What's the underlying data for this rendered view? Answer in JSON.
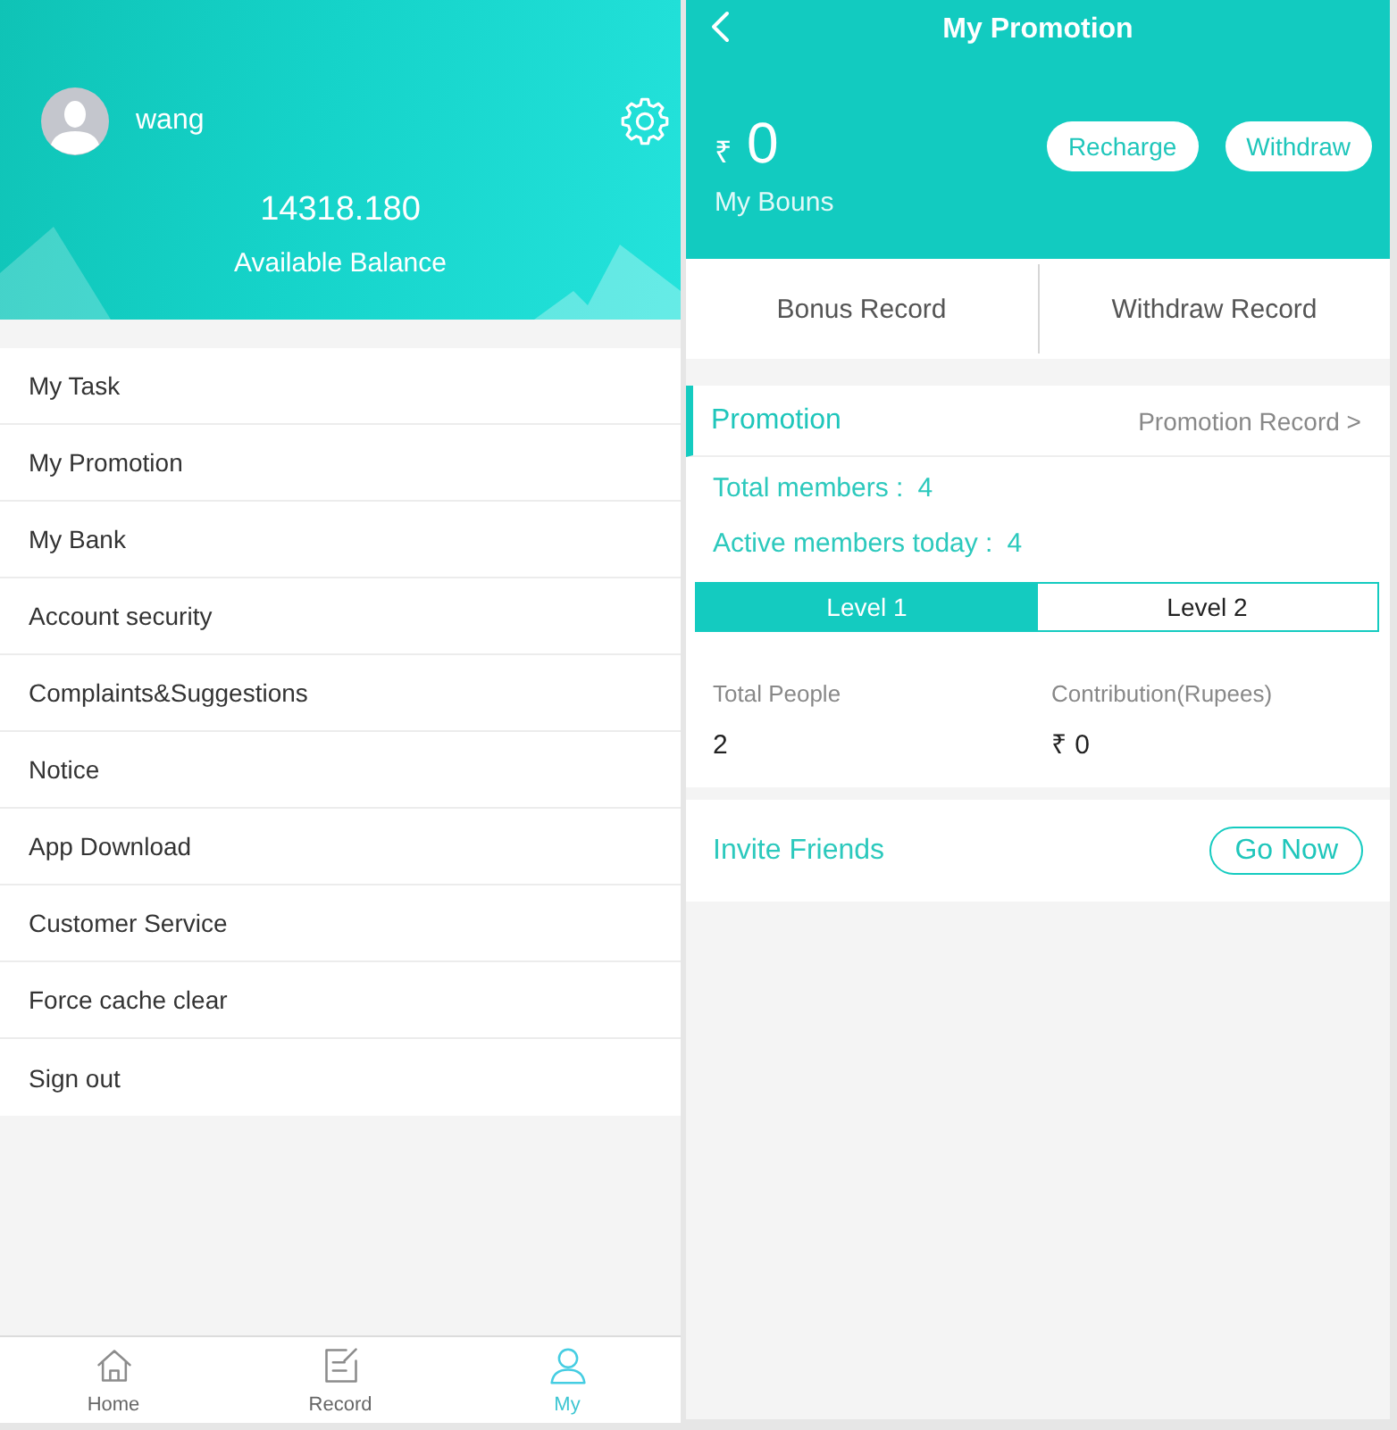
{
  "profile_screen": {
    "username": "wang",
    "balance": "14318.180",
    "balance_label": "Available Balance",
    "menu": [
      "My Task",
      "My Promotion",
      "My Bank",
      "Account security",
      "Complaints&Suggestions",
      "Notice",
      "App Download",
      "Customer Service",
      "Force cache clear",
      "Sign out"
    ],
    "tab_bar": [
      {
        "kind": "home",
        "label": "Home",
        "selected": false
      },
      {
        "kind": "record",
        "label": "Record",
        "selected": false
      },
      {
        "kind": "profile",
        "label": "My",
        "selected": true
      }
    ]
  },
  "promotion_screen": {
    "title": "My Promotion",
    "bonus": {
      "currency": "₹",
      "amount": "0",
      "label": "My Bouns"
    },
    "actions": [
      "Recharge",
      "Withdraw"
    ],
    "records": [
      "Bonus Record",
      "Withdraw Record"
    ],
    "promotion": {
      "title": "Promotion",
      "record_link": "Promotion Record >",
      "stats": [
        {
          "label": "Total members :",
          "value": "4"
        },
        {
          "label": "Active members today :",
          "value": "4"
        }
      ],
      "levels": [
        {
          "label": "Level 1",
          "selected": true
        },
        {
          "label": "Level 2",
          "selected": false
        }
      ],
      "columns": [
        {
          "header": "Total People",
          "value": "2"
        },
        {
          "header": "Contribution(Rupees)",
          "value": "₹ 0"
        }
      ]
    },
    "invite": {
      "label": "Invite Friends",
      "button": "Go Now"
    }
  }
}
